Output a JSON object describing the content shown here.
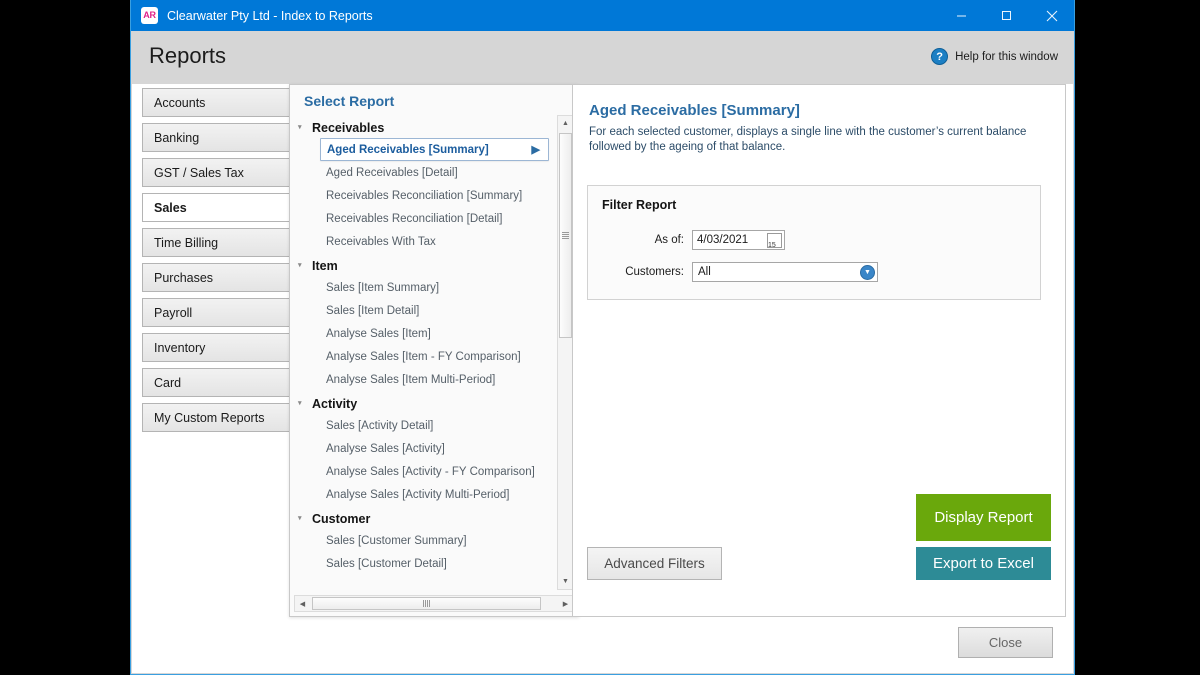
{
  "window": {
    "title": "Clearwater Pty Ltd - Index to Reports",
    "app_icon_text": "AR",
    "minimize_icon": "minimize-icon",
    "maximize_icon": "maximize-icon",
    "close_icon": "close-icon",
    "accent_blue": "#0078d7"
  },
  "header": {
    "page_title": "Reports",
    "help_label": "Help for this window",
    "help_icon_glyph": "?"
  },
  "tabs": [
    {
      "label": "Accounts",
      "selected": false
    },
    {
      "label": "Banking",
      "selected": false
    },
    {
      "label": "GST / Sales Tax",
      "selected": false
    },
    {
      "label": "Sales",
      "selected": true
    },
    {
      "label": "Time Billing",
      "selected": false
    },
    {
      "label": "Purchases",
      "selected": false
    },
    {
      "label": "Payroll",
      "selected": false
    },
    {
      "label": "Inventory",
      "selected": false
    },
    {
      "label": "Card",
      "selected": false
    },
    {
      "label": "My Custom Reports",
      "selected": false
    }
  ],
  "report_panel": {
    "title": "Select Report",
    "selected_arrow_glyph": "▶",
    "expander_glyph": "▾",
    "groups": [
      {
        "name": "Receivables",
        "items": [
          {
            "label": "Aged Receivables [Summary]",
            "selected": true
          },
          {
            "label": "Aged Receivables [Detail]",
            "selected": false
          },
          {
            "label": "Receivables Reconciliation [Summary]",
            "selected": false
          },
          {
            "label": "Receivables Reconciliation [Detail]",
            "selected": false
          },
          {
            "label": "Receivables With Tax",
            "selected": false
          }
        ]
      },
      {
        "name": "Item",
        "items": [
          {
            "label": "Sales [Item Summary]",
            "selected": false
          },
          {
            "label": "Sales [Item Detail]",
            "selected": false
          },
          {
            "label": "Analyse Sales [Item]",
            "selected": false
          },
          {
            "label": "Analyse Sales [Item - FY Comparison]",
            "selected": false
          },
          {
            "label": "Analyse Sales [Item Multi-Period]",
            "selected": false
          }
        ]
      },
      {
        "name": "Activity",
        "items": [
          {
            "label": "Sales [Activity Detail]",
            "selected": false
          },
          {
            "label": "Analyse Sales [Activity]",
            "selected": false
          },
          {
            "label": "Analyse Sales [Activity - FY Comparison]",
            "selected": false
          },
          {
            "label": "Analyse Sales [Activity Multi-Period]",
            "selected": false
          }
        ]
      },
      {
        "name": "Customer",
        "items": [
          {
            "label": "Sales [Customer Summary]",
            "selected": false
          },
          {
            "label": "Sales [Customer Detail]",
            "selected": false
          }
        ]
      }
    ],
    "scrollbars": {
      "vertical_up_glyph": "▲",
      "vertical_down_glyph": "▼",
      "horizontal_left_glyph": "◀",
      "horizontal_right_glyph": "▶"
    }
  },
  "detail": {
    "title": "Aged Receivables [Summary]",
    "description": "For each selected customer, displays a single line with the customer’s current balance followed by the ageing of that balance.",
    "filter": {
      "title": "Filter Report",
      "as_of_label": "As of:",
      "as_of_value": "4/03/2021",
      "calendar_icon_day": "15",
      "customers_label": "Customers:",
      "customers_value": "All"
    },
    "buttons": {
      "display_report": "Display Report",
      "export_to_excel": "Export to Excel",
      "advanced_filters": "Advanced Filters",
      "display_color": "#6aa80c",
      "export_color": "#2d8b96"
    }
  },
  "footer": {
    "close_label": "Close"
  }
}
